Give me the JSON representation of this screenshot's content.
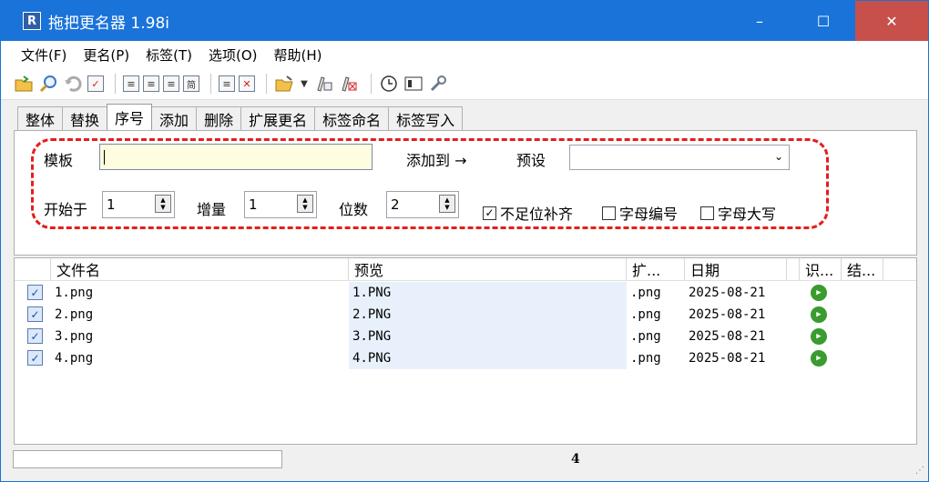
{
  "window": {
    "title": "拖把更名器 1.98i",
    "icon_letter": "R",
    "min_glyph": "–",
    "max_glyph": "☐",
    "close_glyph": "✕"
  },
  "menu": [
    "文件(F)",
    "更名(P)",
    "标签(T)",
    "选项(O)",
    "帮助(H)"
  ],
  "toolbar_icons": [
    "open-folder-icon",
    "search-icon",
    "undo-icon",
    "check-list-icon",
    "file-rename-a-icon",
    "file-rename-b-icon",
    "file-rename-c-icon",
    "simplified-icon",
    "document-icon",
    "delete-document-icon",
    "folder-open-icon",
    "dropdown-arrow-icon",
    "tag-edit-icon",
    "tag-delete-icon",
    "clock-icon",
    "panel-icon",
    "wrench-icon"
  ],
  "tabs": [
    "整体",
    "替换",
    "序号",
    "添加",
    "删除",
    "扩展更名",
    "标签命名",
    "标签写入"
  ],
  "active_tab": "序号",
  "form": {
    "template_label": "模板",
    "template_value": "",
    "add_to_label": "添加到 →",
    "preset_label": "预设",
    "preset_value": "",
    "start_label": "开始于",
    "start_value": "1",
    "increment_label": "增量",
    "increment_value": "1",
    "digits_label": "位数",
    "digits_value": "2",
    "pad_label": "不足位补齐",
    "pad_checked": true,
    "alpha_label": "字母编号",
    "alpha_checked": false,
    "upper_label": "字母大写",
    "upper_checked": false
  },
  "list": {
    "columns": [
      "文件名",
      "预览",
      "扩...",
      "日期",
      "识...",
      "结..."
    ],
    "rows": [
      {
        "name": "1.png",
        "preview": "1.PNG",
        "ext": ".png",
        "date": "2025-08-21"
      },
      {
        "name": "2.png",
        "preview": "2.PNG",
        "ext": ".png",
        "date": "2025-08-21"
      },
      {
        "name": "3.png",
        "preview": "3.PNG",
        "ext": ".png",
        "date": "2025-08-21"
      },
      {
        "name": "4.png",
        "preview": "4.PNG",
        "ext": ".png",
        "date": "2025-08-21"
      }
    ]
  },
  "status": {
    "count": "4"
  }
}
